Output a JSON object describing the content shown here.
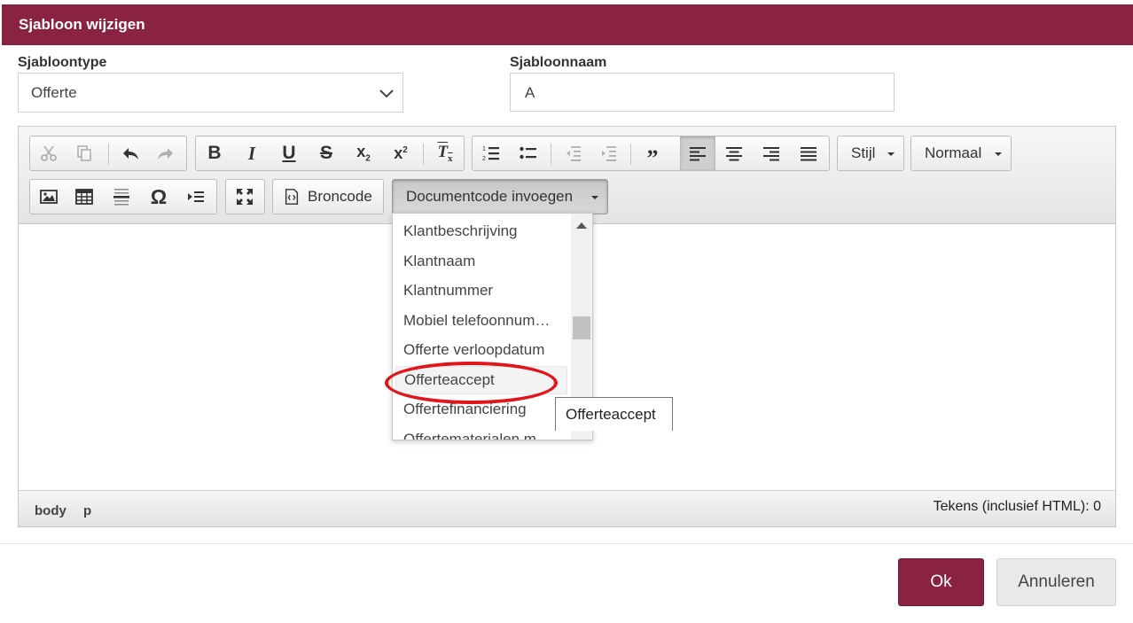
{
  "dialog": {
    "title": "Sjabloon wijzigen"
  },
  "form": {
    "type_label": "Sjabloontype",
    "type_value": "Offerte",
    "name_label": "Sjabloonnaam",
    "name_value": "A"
  },
  "toolbar": {
    "style_label": "Stijl",
    "format_label": "Normaal",
    "source_label": "Broncode",
    "insert_code_label": "Documentcode invoegen"
  },
  "dropdown": {
    "items": [
      "Klantbeschrijving",
      "Klantnaam",
      "Klantnummer",
      "Mobiel telefoonnum…",
      "Offerte verloopdatum",
      "Offerteaccept",
      "Offertefinanciering",
      "Offertematerialen m…"
    ],
    "hovered_index": 5
  },
  "tooltip": {
    "text": "Offerteaccept"
  },
  "statusbar": {
    "path": [
      "body",
      "p"
    ],
    "char_count": "Tekens (inclusief HTML): 0"
  },
  "buttons": {
    "ok": "Ok",
    "cancel": "Annuleren"
  },
  "colors": {
    "brand": "#8a2342",
    "highlight": "#e0161b"
  }
}
